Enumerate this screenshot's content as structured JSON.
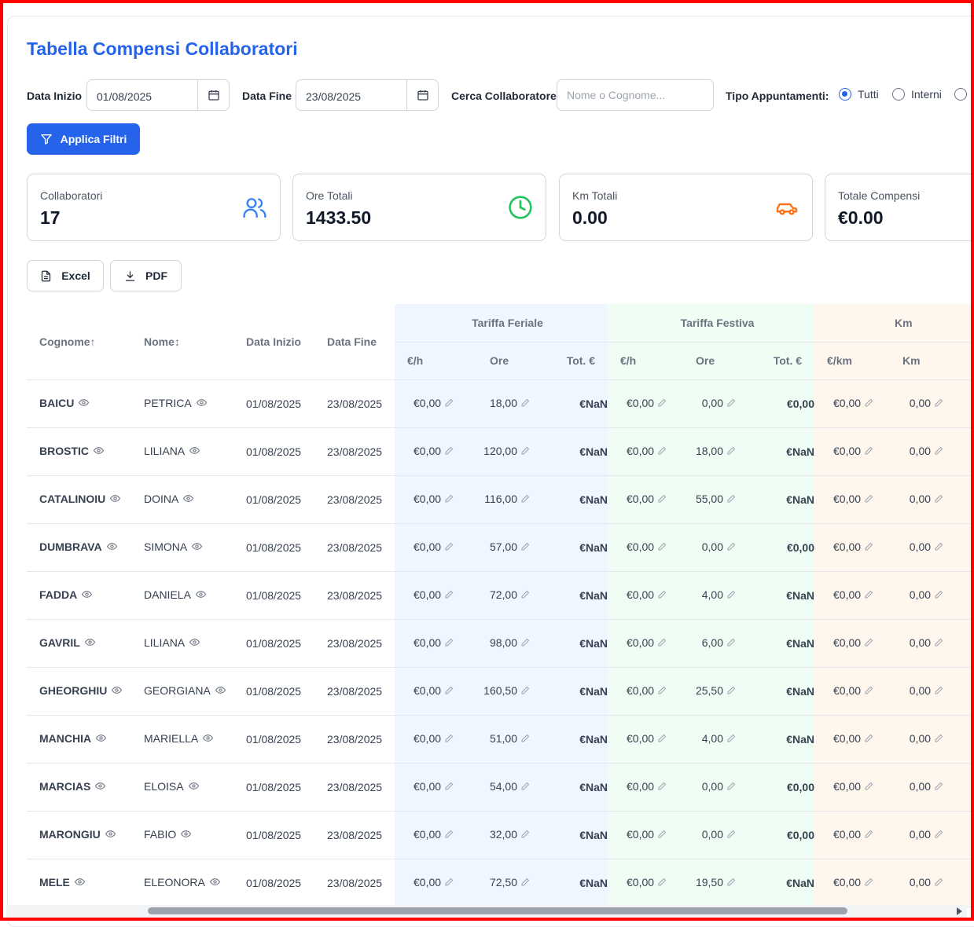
{
  "title": "Tabella Compensi Collaboratori",
  "filters": {
    "start_label": "Data Inizio",
    "start_value": "01/08/2025",
    "end_label": "Data Fine",
    "end_value": "23/08/2025",
    "search_label": "Cerca Collaboratore",
    "search_placeholder": "Nome o Cognome...",
    "type_label": "Tipo Appuntamenti:",
    "type_options": [
      "Tutti",
      "Interni",
      ""
    ],
    "type_selected": "Tutti",
    "apply_label": "Applica Filtri"
  },
  "stats": [
    {
      "label": "Collaboratori",
      "value": "17",
      "icon": "users-icon",
      "color": "#3b82f6"
    },
    {
      "label": "Ore Totali",
      "value": "1433.50",
      "icon": "clock-icon",
      "color": "#22c55e"
    },
    {
      "label": "Km Totali",
      "value": "0.00",
      "icon": "car-icon",
      "color": "#f97316"
    },
    {
      "label": "Totale Compensi",
      "value": "€0.00",
      "icon": "euro-icon",
      "color": "#8b5cf6"
    }
  ],
  "export": {
    "excel_label": "Excel",
    "pdf_label": "PDF"
  },
  "table": {
    "headers": {
      "cognome": "Cognome↑",
      "nome": "Nome↕",
      "data_inizio": "Data Inizio",
      "data_fine": "Data Fine",
      "group_feriale": "Tariffa Feriale",
      "group_festiva": "Tariffa Festiva",
      "group_km": "Km",
      "rate_h": "€/h",
      "ore": "Ore",
      "tot": "Tot. €",
      "rate_km": "€/km",
      "km": "Km"
    },
    "rows": [
      {
        "cognome": "BAICU",
        "nome": "PETRICA",
        "inizio": "01/08/2025",
        "fine": "23/08/2025",
        "fer_rate": "€0,00",
        "fer_ore": "18,00",
        "fer_tot": "€NaN",
        "fes_rate": "€0,00",
        "fes_ore": "0,00",
        "fes_tot": "€0,00",
        "km_rate": "€0,00",
        "km": "0,00"
      },
      {
        "cognome": "BROSTIC",
        "nome": "LILIANA",
        "inizio": "01/08/2025",
        "fine": "23/08/2025",
        "fer_rate": "€0,00",
        "fer_ore": "120,00",
        "fer_tot": "€NaN",
        "fes_rate": "€0,00",
        "fes_ore": "18,00",
        "fes_tot": "€NaN",
        "km_rate": "€0,00",
        "km": "0,00"
      },
      {
        "cognome": "CATALINOIU",
        "nome": "DOINA",
        "inizio": "01/08/2025",
        "fine": "23/08/2025",
        "fer_rate": "€0,00",
        "fer_ore": "116,00",
        "fer_tot": "€NaN",
        "fes_rate": "€0,00",
        "fes_ore": "55,00",
        "fes_tot": "€NaN",
        "km_rate": "€0,00",
        "km": "0,00"
      },
      {
        "cognome": "DUMBRAVA",
        "nome": "SIMONA",
        "inizio": "01/08/2025",
        "fine": "23/08/2025",
        "fer_rate": "€0,00",
        "fer_ore": "57,00",
        "fer_tot": "€NaN",
        "fes_rate": "€0,00",
        "fes_ore": "0,00",
        "fes_tot": "€0,00",
        "km_rate": "€0,00",
        "km": "0,00"
      },
      {
        "cognome": "FADDA",
        "nome": "DANIELA",
        "inizio": "01/08/2025",
        "fine": "23/08/2025",
        "fer_rate": "€0,00",
        "fer_ore": "72,00",
        "fer_tot": "€NaN",
        "fes_rate": "€0,00",
        "fes_ore": "4,00",
        "fes_tot": "€NaN",
        "km_rate": "€0,00",
        "km": "0,00"
      },
      {
        "cognome": "GAVRIL",
        "nome": "LILIANA",
        "inizio": "01/08/2025",
        "fine": "23/08/2025",
        "fer_rate": "€0,00",
        "fer_ore": "98,00",
        "fer_tot": "€NaN",
        "fes_rate": "€0,00",
        "fes_ore": "6,00",
        "fes_tot": "€NaN",
        "km_rate": "€0,00",
        "km": "0,00"
      },
      {
        "cognome": "GHEORGHIU",
        "nome": "GEORGIANA",
        "inizio": "01/08/2025",
        "fine": "23/08/2025",
        "fer_rate": "€0,00",
        "fer_ore": "160,50",
        "fer_tot": "€NaN",
        "fes_rate": "€0,00",
        "fes_ore": "25,50",
        "fes_tot": "€NaN",
        "km_rate": "€0,00",
        "km": "0,00"
      },
      {
        "cognome": "MANCHIA",
        "nome": "MARIELLA",
        "inizio": "01/08/2025",
        "fine": "23/08/2025",
        "fer_rate": "€0,00",
        "fer_ore": "51,00",
        "fer_tot": "€NaN",
        "fes_rate": "€0,00",
        "fes_ore": "4,00",
        "fes_tot": "€NaN",
        "km_rate": "€0,00",
        "km": "0,00"
      },
      {
        "cognome": "MARCIAS",
        "nome": "ELOISA",
        "inizio": "01/08/2025",
        "fine": "23/08/2025",
        "fer_rate": "€0,00",
        "fer_ore": "54,00",
        "fer_tot": "€NaN",
        "fes_rate": "€0,00",
        "fes_ore": "0,00",
        "fes_tot": "€0,00",
        "km_rate": "€0,00",
        "km": "0,00"
      },
      {
        "cognome": "MARONGIU",
        "nome": "FABIO",
        "inizio": "01/08/2025",
        "fine": "23/08/2025",
        "fer_rate": "€0,00",
        "fer_ore": "32,00",
        "fer_tot": "€NaN",
        "fes_rate": "€0,00",
        "fes_ore": "0,00",
        "fes_tot": "€0,00",
        "km_rate": "€0,00",
        "km": "0,00"
      },
      {
        "cognome": "MELE",
        "nome": "ELEONORA",
        "inizio": "01/08/2025",
        "fine": "23/08/2025",
        "fer_rate": "€0,00",
        "fer_ore": "72,50",
        "fer_tot": "€NaN",
        "fes_rate": "€0,00",
        "fes_ore": "19,50",
        "fes_tot": "€NaN",
        "km_rate": "€0,00",
        "km": "0,00"
      }
    ]
  },
  "colors": {
    "accent": "#2563eb",
    "feriale_bg": "#eff6ff",
    "festiva_bg": "#f0fdf4",
    "km_bg": "#fff7ed"
  }
}
